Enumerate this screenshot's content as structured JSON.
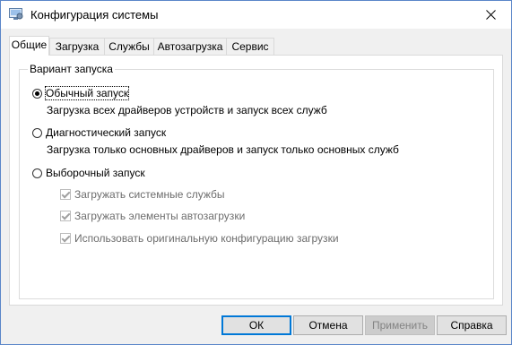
{
  "window": {
    "title": "Конфигурация системы"
  },
  "tabs": [
    "Общие",
    "Загрузка",
    "Службы",
    "Автозагрузка",
    "Сервис"
  ],
  "group": {
    "legend": "Вариант запуска",
    "options": [
      {
        "label": "Обычный запуск",
        "description": "Загрузка всех драйверов устройств и запуск всех служб",
        "selected": true
      },
      {
        "label": "Диагностический запуск",
        "description": "Загрузка только основных драйверов и запуск только основных служб",
        "selected": false
      },
      {
        "label": "Выборочный запуск",
        "selected": false
      }
    ],
    "checkboxes": [
      {
        "label": "Загружать системные службы",
        "checked": true,
        "enabled": false
      },
      {
        "label": "Загружать элементы автозагрузки",
        "checked": true,
        "enabled": false
      },
      {
        "label": "Использовать оригинальную конфигурацию загрузки",
        "checked": true,
        "enabled": false
      }
    ]
  },
  "buttons": {
    "ok": "ОК",
    "cancel": "Отмена",
    "apply": "Применить",
    "help": "Справка"
  },
  "colors": {
    "title_border": "#5a86c9",
    "default_button_border": "#0078d7"
  }
}
